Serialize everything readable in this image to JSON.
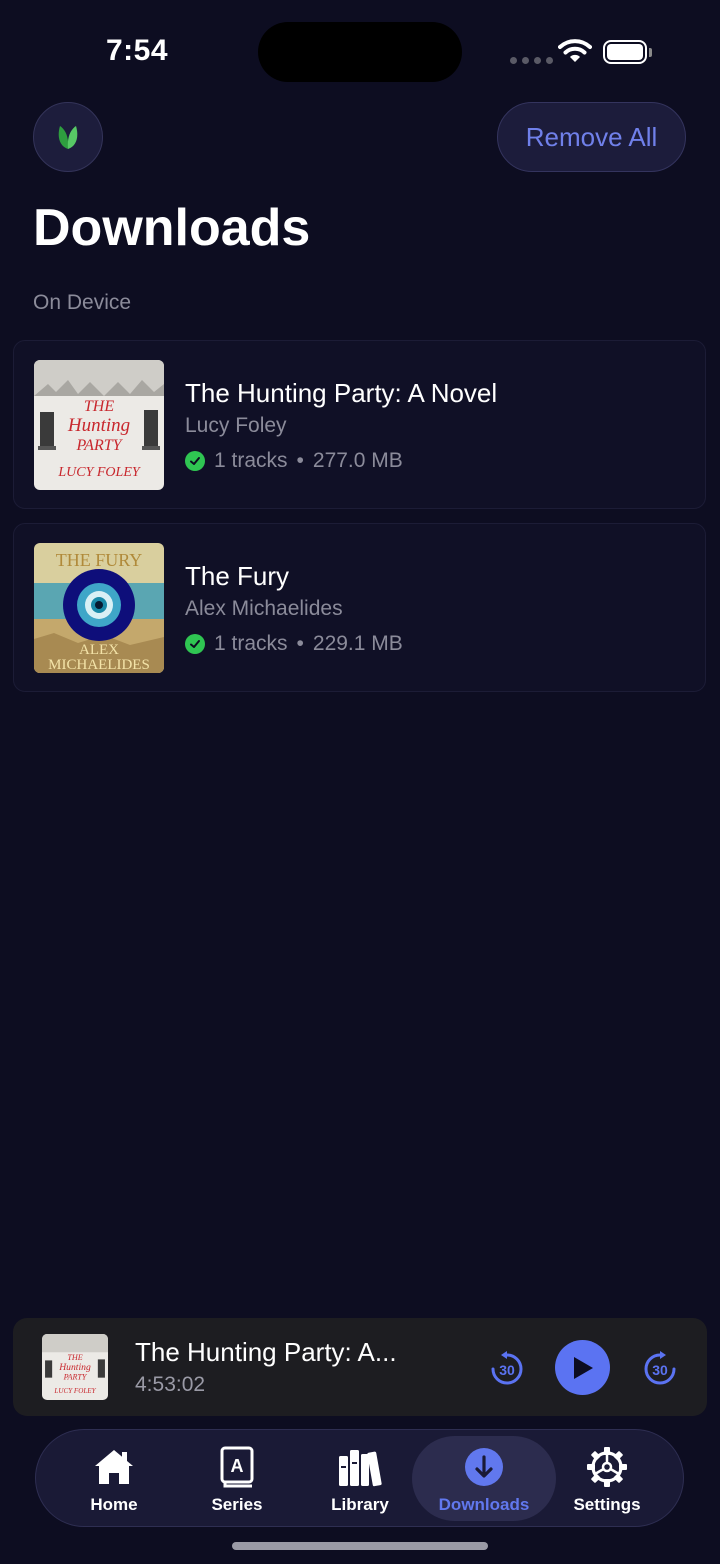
{
  "status_bar": {
    "time": "7:54"
  },
  "header": {
    "remove_all_label": "Remove All"
  },
  "page": {
    "title": "Downloads",
    "section_label": "On Device"
  },
  "downloads": [
    {
      "title": "The Hunting Party: A Novel",
      "author": "Lucy Foley",
      "tracks": "1 tracks",
      "size": "277.0 MB",
      "status": "downloaded",
      "cover_lines": [
        "THE",
        "Hunting",
        "PARTY",
        "LUCY FOLEY"
      ]
    },
    {
      "title": "The Fury",
      "author": "Alex Michaelides",
      "tracks": "1 tracks",
      "size": "229.1 MB",
      "status": "downloaded",
      "cover_lines": [
        "THE FURY",
        "ALEX",
        "MICHAELIDES"
      ]
    }
  ],
  "mini_player": {
    "title": "The Hunting Party: A...",
    "time": "4:53:02",
    "skip_back": "30",
    "skip_forward": "30"
  },
  "tabs": [
    {
      "label": "Home",
      "icon": "house-icon"
    },
    {
      "label": "Series",
      "icon": "book-icon"
    },
    {
      "label": "Library",
      "icon": "books-icon"
    },
    {
      "label": "Downloads",
      "icon": "download-icon",
      "active": true
    },
    {
      "label": "Settings",
      "icon": "gear-icon"
    }
  ],
  "colors": {
    "background": "#0d0d21",
    "accent": "#5b73f2",
    "success": "#2fc552"
  }
}
